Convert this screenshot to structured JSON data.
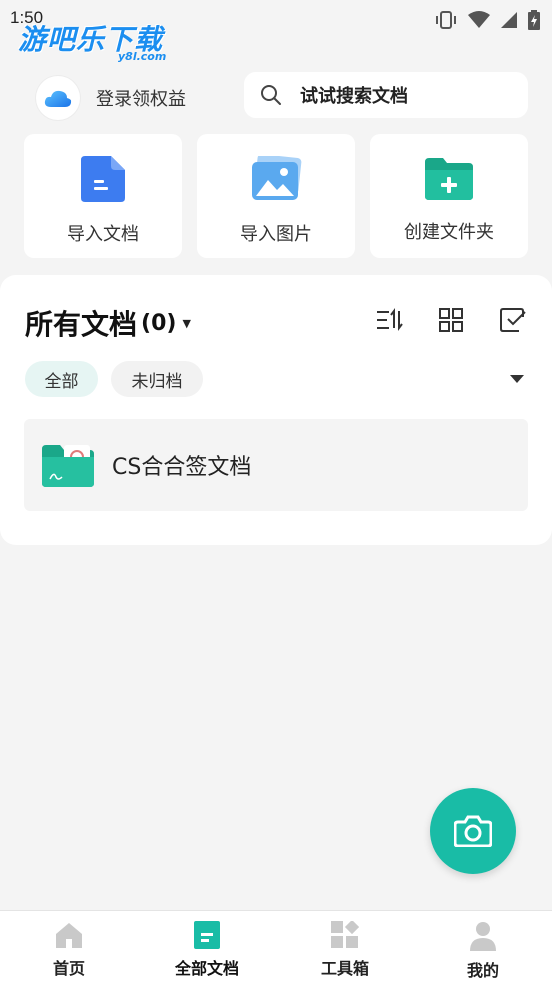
{
  "status_bar": {
    "time": "1:50"
  },
  "watermark": {
    "title": "游吧乐下载",
    "sub": "y8l.com"
  },
  "header": {
    "login_label": "登录领权益",
    "search_placeholder": "试试搜索文档"
  },
  "quick_actions": [
    {
      "label": "导入文档",
      "icon": "document-icon"
    },
    {
      "label": "导入图片",
      "icon": "image-icon"
    },
    {
      "label": "创建文件夹",
      "icon": "folder-add-icon"
    }
  ],
  "documents": {
    "title": "所有文档",
    "count": "(0)",
    "filters": [
      "全部",
      "未归档"
    ],
    "items": [
      {
        "name": "CS合合签文档",
        "icon": "folder-icon"
      }
    ]
  },
  "bottom_nav": {
    "items": [
      {
        "label": "首页",
        "icon": "home-icon"
      },
      {
        "label": "全部文档",
        "icon": "docs-icon",
        "active": true
      },
      {
        "label": "工具箱",
        "icon": "toolbox-icon"
      },
      {
        "label": "我的",
        "icon": "profile-icon"
      }
    ]
  },
  "colors": {
    "accent": "#19bca6",
    "blue": "#3d7cf0",
    "chip_active_bg": "#e6f5f3"
  }
}
